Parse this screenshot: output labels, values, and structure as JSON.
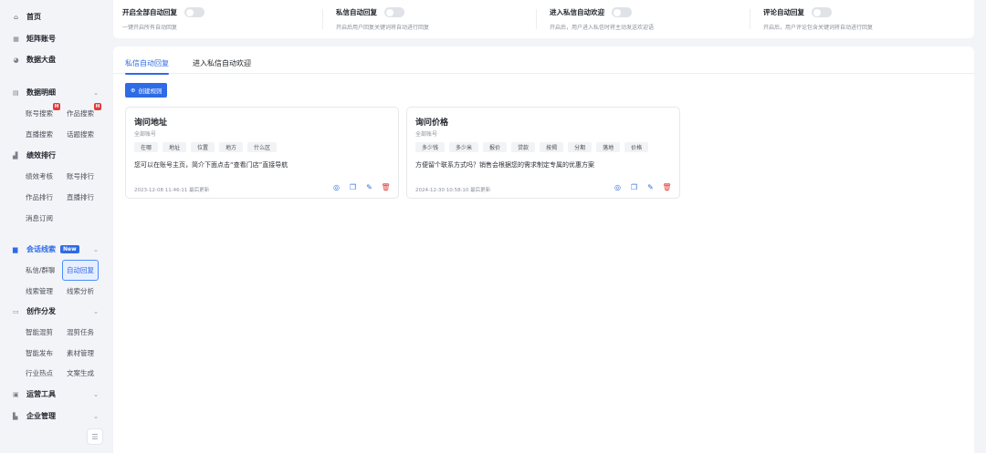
{
  "sidebar": {
    "home": "首页",
    "matrix": "矩阵账号",
    "dashboard": "数据大盘",
    "data_detail": {
      "label": "数据明细",
      "items": [
        "账号搜索",
        "作品搜索",
        "直播搜索",
        "话题搜索"
      ],
      "hot_badge": "H"
    },
    "performance": {
      "label": "绩效排行",
      "items": [
        "绩效考核",
        "账号排行",
        "作品排行",
        "直播排行",
        "消息订阅"
      ]
    },
    "leads": {
      "label": "会话线索",
      "badge": "New",
      "items": [
        "私信/群聊",
        "自动回复",
        "线索管理",
        "线索分析"
      ]
    },
    "creation": {
      "label": "创作分发",
      "items": [
        "智能混剪",
        "混剪任务",
        "智能发布",
        "素材管理",
        "行业热点",
        "文案生成"
      ]
    },
    "ops_tools": "运营工具",
    "enterprise": "企业管理"
  },
  "settings": [
    {
      "title": "开启全部自动回复",
      "desc": "一键开启所有自动回复"
    },
    {
      "title": "私信自动回复",
      "desc": "开启后用户回复关键词将自动进行回复"
    },
    {
      "title": "进入私信自动欢迎",
      "desc": "开启后，用户进入私信时将主动发送欢迎语"
    },
    {
      "title": "评论自动回复",
      "desc": "开启后，用户评论包含关键词将自动进行回复"
    }
  ],
  "tabs": [
    "私信自动回复",
    "进入私信自动欢迎"
  ],
  "create_button": "创建规则",
  "cards": [
    {
      "title": "询问地址",
      "scope": "全部账号",
      "keywords": [
        "在哪",
        "地址",
        "位置",
        "地方",
        "什么区"
      ],
      "reply": "您可以在账号主页，简介下面点击“查看门店”直接导航",
      "updated": "2023-12-08 11:46:11 最后更新"
    },
    {
      "title": "询问价格",
      "scope": "全部账号",
      "keywords": [
        "多少钱",
        "多少米",
        "报价",
        "贷款",
        "按揭",
        "分期",
        "落地",
        "价格"
      ],
      "reply": "方便留个联系方式吗？销售会根据您的需求制定专属的优惠方案",
      "updated": "2024-12-30 10:58:10 最后更新"
    }
  ],
  "colors": {
    "accent": "#2e6be6",
    "danger": "#e23b3b"
  }
}
